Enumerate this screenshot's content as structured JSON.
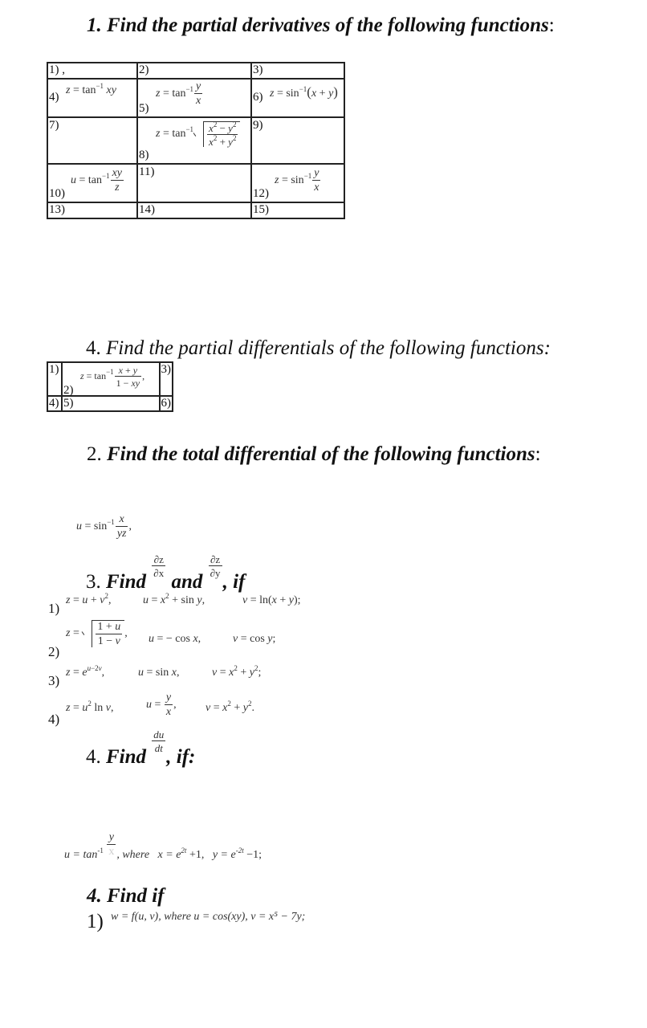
{
  "section1": {
    "heading_num": "1.",
    "heading_text": "Find the partial derivatives of the following functions",
    "heading_colon": ":",
    "cells": [
      {
        "label": "1) ,",
        "formula": ""
      },
      {
        "label": "2)",
        "formula": ""
      },
      {
        "label": "3)",
        "formula": ""
      },
      {
        "label": "4)",
        "formula": "z = tan⁻¹ xy"
      },
      {
        "label": "5)",
        "formula": "z = tan⁻¹ y/x"
      },
      {
        "label": "6)",
        "formula": "z = sin⁻¹(x + y)"
      },
      {
        "label": "7)",
        "formula": ""
      },
      {
        "label": "8)",
        "formula": "z = tan⁻¹ √((x² − y²)/(x² + y²))"
      },
      {
        "label": "9)",
        "formula": ""
      },
      {
        "label": "10)",
        "formula": "u = tan⁻¹ xy/z"
      },
      {
        "label": "11)",
        "formula": ""
      },
      {
        "label": "12)",
        "formula": "z = sin⁻¹ y/x"
      },
      {
        "label": "13)",
        "formula": ""
      },
      {
        "label": "14)",
        "formula": ""
      },
      {
        "label": "15)",
        "formula": ""
      }
    ]
  },
  "section4a": {
    "heading_num": "4.",
    "heading_text": "Find the partial differentials of the following functions:",
    "cells": [
      {
        "label": "1)"
      },
      {
        "label": "2)",
        "formula": "z = tan⁻¹ (x + y)/(1 − xy),"
      },
      {
        "label": "3)"
      },
      {
        "label": "4)"
      },
      {
        "label": "5)"
      },
      {
        "label": "6)"
      }
    ]
  },
  "section2": {
    "heading_num": "2.",
    "heading_text": "Find the total differential of the following functions",
    "heading_colon": ":",
    "formula": "u = sin⁻¹ x/(yz),"
  },
  "section3": {
    "heading_num": "3.",
    "heading_find": "Find",
    "heading_and": "and",
    "heading_if": ", if",
    "dz": "∂z",
    "dx": "∂x",
    "dy": "∂y",
    "items": [
      {
        "label": "1)",
        "parts": [
          "z = u + v²,",
          "u = x² + sin y,",
          "v = ln(x + y);"
        ]
      },
      {
        "label": "2)",
        "parts": [
          "z = √((1 + u)/(1 − v)),",
          "u = − cos x,",
          "v = cos y;"
        ]
      },
      {
        "label": "3)",
        "parts": [
          "z = e^(u−2v),",
          "u = sin x,",
          "v = x² + y²;"
        ]
      },
      {
        "label": "4)",
        "parts": [
          "z = u² ln v,",
          "u = y/x,",
          "v = x² + y²."
        ]
      }
    ]
  },
  "section4b": {
    "heading_num": "4.",
    "heading_find": "Find",
    "du": "du",
    "dt": "dt",
    "heading_if": ", if:",
    "formula_lhs": "u = tan",
    "formula_sup": "-1",
    "formula_num": "y",
    "formula_where": ", where",
    "formula_x": "x = e",
    "formula_x_sup": "2t",
    "formula_x_tail": " +1,",
    "formula_y": "y = e",
    "formula_y_sup": "-2t",
    "formula_y_tail": " −1;"
  },
  "section4c": {
    "heading": "4. Find if",
    "item_label": "1)",
    "formula": "w = f(u, v), where u = cos(xy), v = x⁵ − 7y;"
  }
}
